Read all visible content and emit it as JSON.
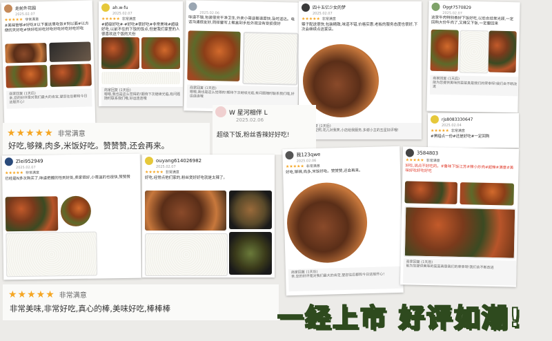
{
  "stars": "★★★★★",
  "satisfaction": "非常满意",
  "satisfaction_small": "非常满意",
  "reply_label": "商家回复 (1天后)",
  "reviews": [
    {
      "user": "走前外花园",
      "date": "2025.02.07",
      "text": "#美味管够#好吃#以下面这里吃饭#到以面#以方便的天好吃#快好吃好吃好吃好吃好吃好吃好吃"
    },
    {
      "user": "ah.w-fu",
      "date": "2025.02.07",
      "text": "#超级好吃#·#好吃#很好吃#非常美味#超级好吃,以前不住的下饭的饭点,但是我们家里的人很喜欢这个饭的大份"
    },
    {
      "user": "",
      "date": "2025.02.06",
      "text": "味道不错,包装很完干净卫生,外卖小哥送餐速度快,及时送达。电话沟通很友好,同样要写上餐盒到手后外观没有受损很好"
    },
    {
      "user": "四十五亿少女的梦",
      "date": "2025.02.07",
      "text": "辣子配送很快,包装精致,味道不错,价格实惠,老板的服务态度也很好,下次会继续点这家店。"
    },
    {
      "user": "Oggt7570829",
      "date": "2025.02.07",
      "text": "这家牛肉特别香好下饭好吃,以后会经常光顾,一定回购大份牛肉了,又辣又下饭,一定要回来"
    },
    {
      "user": "Zlei952949",
      "date": "2025.02.07",
      "text": "已经是N多次购买了,味道把握的恰到好处,卖家很好,小哥送的也很快,赞赞赞"
    },
    {
      "user": "ouyang614026982",
      "date": "2025.02.07",
      "text": "好吃,经常点他们家的,粉丝煲好好吃就是太辣了。"
    },
    {
      "user": "我123qwe",
      "date": "2025.02.06",
      "text": "好吃,够辣,肉多,米饭好吃。赞赞赞,还会再来。"
    },
    {
      "user": "",
      "date": "2025.02.06",
      "text": "好吃,说点不好吃的。#鲁味下饭江苏#辣小炒肉#超辣#满意#美味好吃好吃好吃"
    },
    {
      "user": "rjs8083330647",
      "date": "2025.02.04",
      "text": "#黑暗点一份#还是好吃#一定回购"
    }
  ],
  "big_reviews": [
    {
      "text": "好吃,够辣,肉多,米饭好吃。赞赞赞,还会再来。"
    },
    {
      "user": "W 星河相伴 L",
      "date": "2025.02.06",
      "text": "超级下饭,粉丝香辣好好吃!"
    },
    {
      "text": "非常美味,非常好吃,真心的棒,美味好吃,棒棒棒"
    }
  ],
  "replies": [
    "亲,您的好评是对我们最大的肯定,望您往后都和今日这般开心!",
    "嗯嗯,我也是这么觉得的!期待下次继续光临,有问题随时联系我们哦,好运连连哦",
    "太阳当空照,花儿对我笑,小店给我服务,多谢小主的五星好评哦!",
    "能为您提供美味的菜菜真是我们的荣幸呀!我们会不断改进"
  ],
  "slogan": "一经上市 好评如潮!"
}
